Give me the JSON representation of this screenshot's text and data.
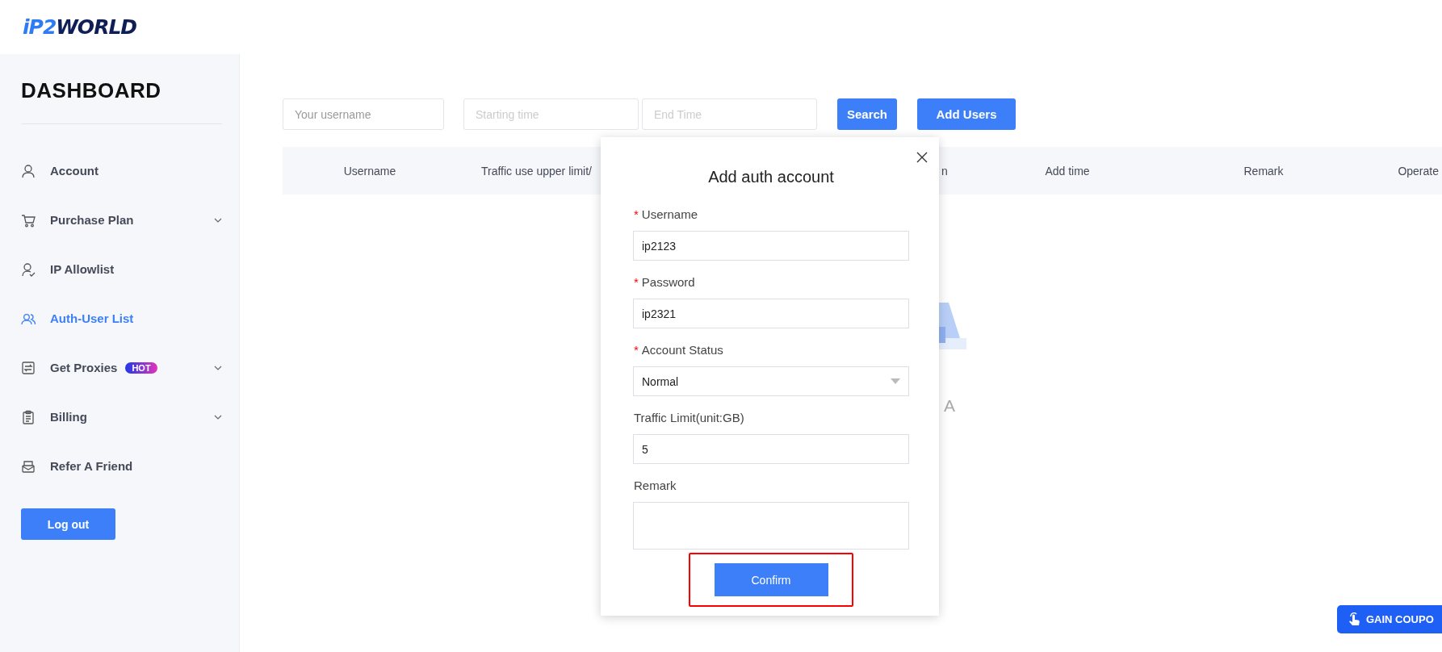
{
  "logo": {
    "prefix": "iP2",
    "suffix": "WORLD"
  },
  "sidebar": {
    "title": "DASHBOARD",
    "items": [
      {
        "label": "Account",
        "selected": false,
        "expandable": false
      },
      {
        "label": "Purchase Plan",
        "selected": false,
        "expandable": true
      },
      {
        "label": "IP Allowlist",
        "selected": false,
        "expandable": false
      },
      {
        "label": "Auth-User List",
        "selected": true,
        "expandable": false
      },
      {
        "label": "Get Proxies",
        "selected": false,
        "expandable": true,
        "badge": "HOT"
      },
      {
        "label": "Billing",
        "selected": false,
        "expandable": true
      },
      {
        "label": "Refer A Friend",
        "selected": false,
        "expandable": false
      }
    ],
    "logout": "Log out"
  },
  "filters": {
    "username_placeholder": "Your username",
    "start_placeholder": "Starting time",
    "end_placeholder": "End Time",
    "search": "Search",
    "add": "Add Users"
  },
  "table": {
    "columns": [
      "Username",
      "Traffic use upper limit/",
      "n",
      "Add time",
      "Remark",
      "Operate"
    ]
  },
  "empty_state": {
    "text": "A"
  },
  "modal": {
    "title": "Add auth account",
    "fields": [
      {
        "kind": "text",
        "label": "Username",
        "marker": "*",
        "value": "ip2123"
      },
      {
        "kind": "text",
        "label": "Password",
        "marker": "*",
        "value": "ip2321"
      },
      {
        "kind": "select",
        "label": "Account Status",
        "marker": "*",
        "value": "Normal"
      },
      {
        "kind": "text",
        "label": "Traffic Limit(unit:GB)",
        "value": "5"
      },
      {
        "kind": "textarea",
        "label": "Remark"
      }
    ],
    "confirm": "Confirm",
    "highlighted": true
  },
  "coupon": "GAIN COUPO"
}
